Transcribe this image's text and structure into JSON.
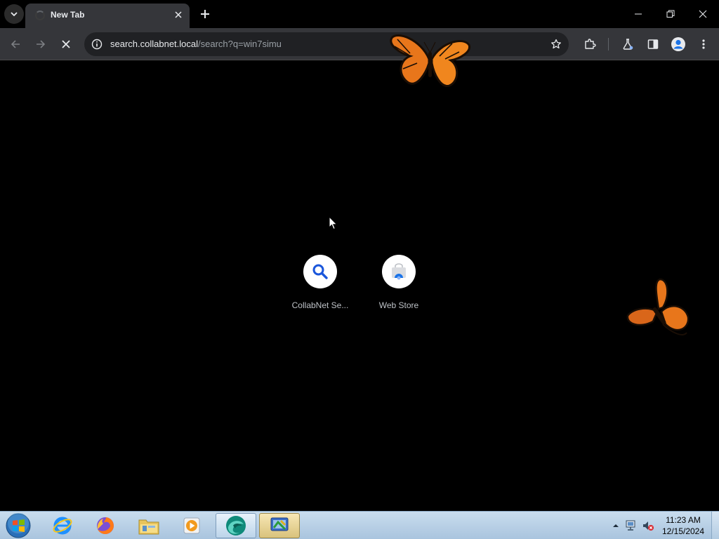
{
  "browser": {
    "tab": {
      "title": "New Tab"
    },
    "omnibox": {
      "url_host": "search.collabnet.local",
      "url_path": "/search?q=win7simu"
    }
  },
  "new_tab_page": {
    "shortcuts": [
      {
        "label": "CollabNet Se...",
        "icon": "search-icon"
      },
      {
        "label": "Web Store",
        "icon": "web-store-icon"
      }
    ]
  },
  "taskbar": {
    "pinned": [
      "internet-explorer-icon",
      "firefox-icon",
      "file-explorer-icon",
      "media-player-icon",
      "browser-app-icon",
      "control-app-icon"
    ],
    "clock": {
      "time": "11:23 AM",
      "date": "12/15/2024"
    }
  },
  "colors": {
    "tab_active": "#35363a",
    "toolbar": "#35363a",
    "omnibox": "#202124",
    "taskbar": "#b8d0e6",
    "accent_blue": "#1a73e8"
  }
}
